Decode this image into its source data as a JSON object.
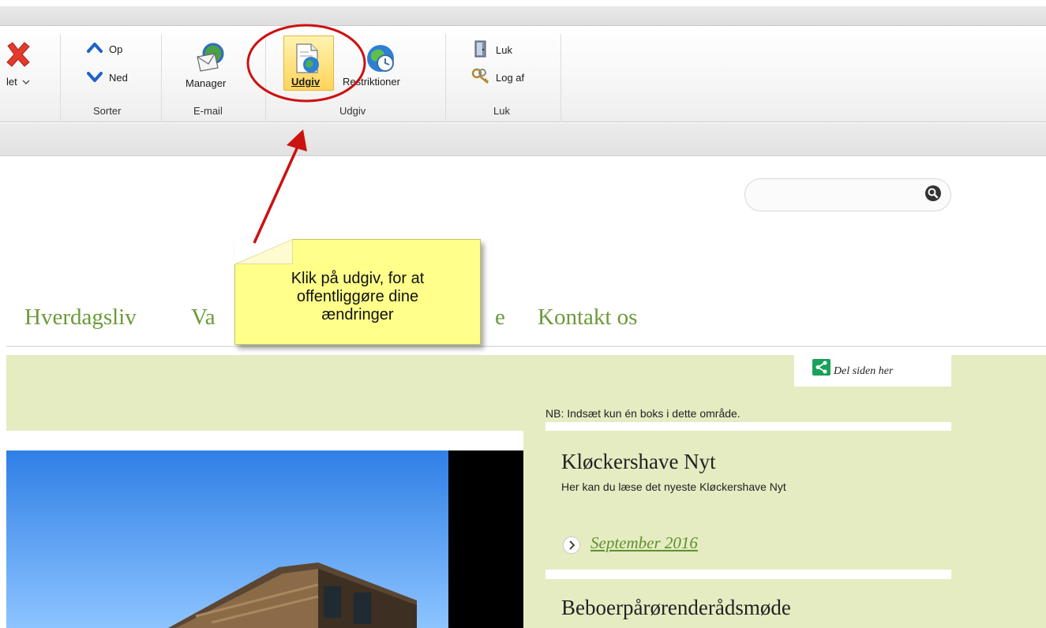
{
  "ribbon": {
    "delete_label": "let",
    "sort": {
      "up_label": "Op",
      "down_label": "Ned",
      "group_label": "Sorter"
    },
    "email": {
      "manager_label": "Manager",
      "group_label": "E-mail"
    },
    "publish": {
      "udgiv_label": "Udgiv",
      "restrictions_label": "Restriktioner",
      "group_label": "Udgiv"
    },
    "close": {
      "luk_label": "Luk",
      "logoff_label": "Log af",
      "group_label": "Luk"
    }
  },
  "nav": {
    "items": [
      "Hverdagsliv",
      "Va",
      "e",
      "Kontakt os"
    ]
  },
  "share": {
    "label": "Del siden her"
  },
  "sidebar": {
    "note": "NB: Indsæt kun én boks i dette område.",
    "news_title": "Kløckershave Nyt",
    "news_subtitle": "Her kan du læse det nyeste Kløckershave Nyt",
    "news_link": "September 2016",
    "next_title": "Beboerpårørenderådsmøde"
  },
  "callout": {
    "text": "Klik på udgiv, for at\noffentliggøre dine\nændringer"
  },
  "colors": {
    "nav_green": "#6b9a3a",
    "content_bg": "#e5ecc2",
    "callout_yellow": "#ffff8a",
    "annotation_red": "#cc1111"
  }
}
